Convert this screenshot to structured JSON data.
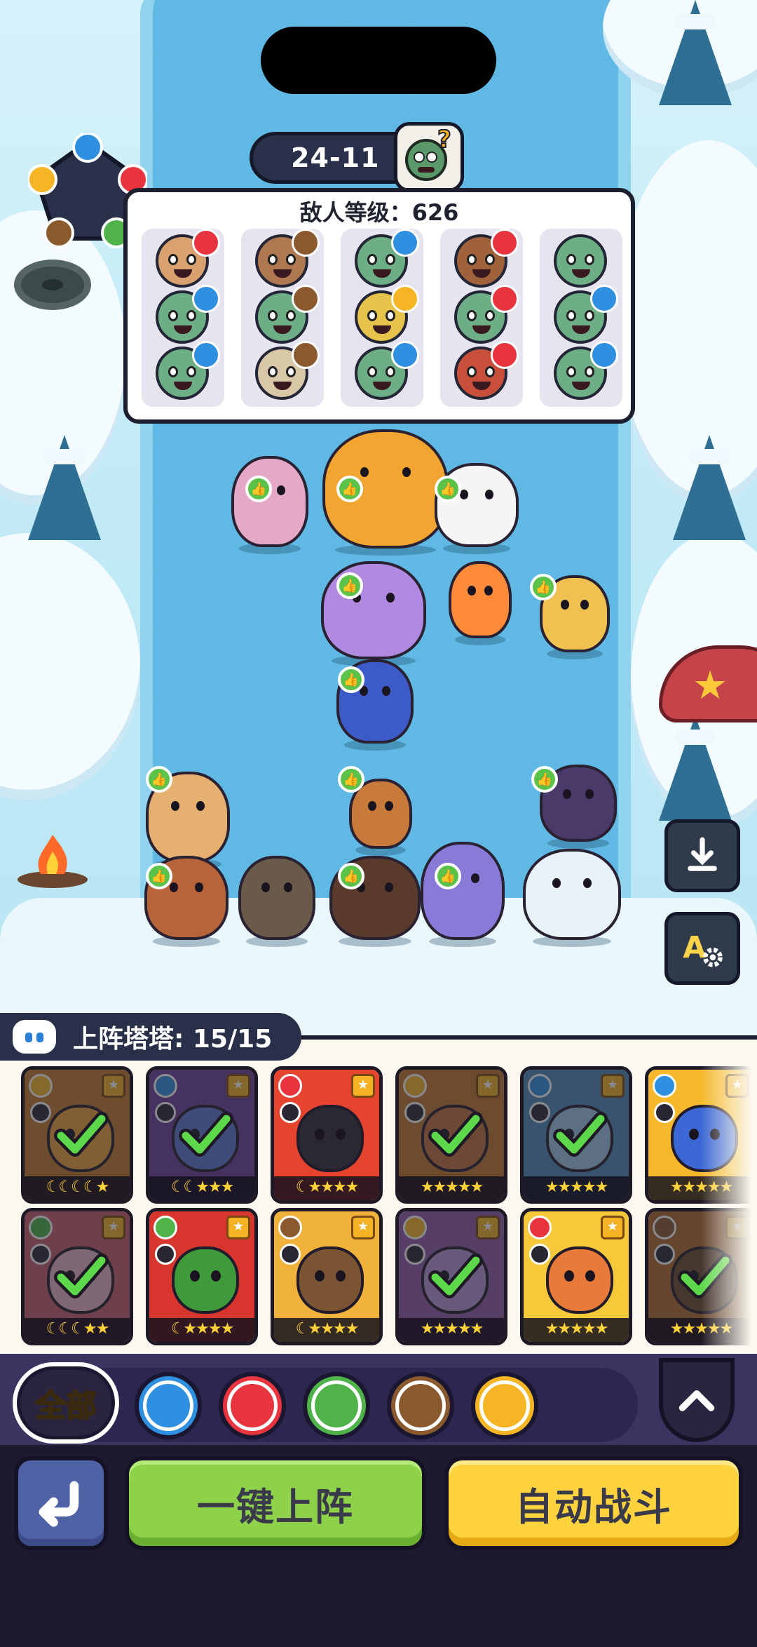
{
  "stage": {
    "label": "24-11"
  },
  "enemy_panel": {
    "title": "敌人等级：626",
    "columns": [
      {
        "enemies": [
          {
            "icon": "pirate-enemy",
            "element": "fire"
          },
          {
            "icon": "zombie-enemy",
            "element": "water"
          },
          {
            "icon": "zombie-enemy",
            "element": "water"
          }
        ]
      },
      {
        "enemies": [
          {
            "icon": "cowboy-enemy",
            "element": "earth"
          },
          {
            "icon": "zombie-enemy",
            "element": "earth"
          },
          {
            "icon": "mummy-enemy",
            "element": "earth"
          }
        ]
      },
      {
        "enemies": [
          {
            "icon": "zombie-enemy",
            "element": "water"
          },
          {
            "icon": "robot-enemy",
            "element": "lightning"
          },
          {
            "icon": "zombie-enemy",
            "element": "water"
          }
        ]
      },
      {
        "enemies": [
          {
            "icon": "bandit-enemy",
            "element": "fire"
          },
          {
            "icon": "zombie-enemy",
            "element": "fire"
          },
          {
            "icon": "brute-enemy",
            "element": "fire"
          }
        ]
      },
      {
        "enemies": [
          {
            "icon": "zombie-enemy",
            "element": "none"
          },
          {
            "icon": "zombie-enemy",
            "element": "water"
          },
          {
            "icon": "zombie-enemy",
            "element": "water"
          }
        ]
      }
    ]
  },
  "roster": {
    "label": "上阵塔塔: 15/15"
  },
  "cards_row1": [
    {
      "element": "lightning",
      "deployed": true,
      "stars": "☾☾☾☾★",
      "bg": "#c47b2a",
      "creature": "#f0a03a"
    },
    {
      "element": "water",
      "deployed": true,
      "stars": "☾☾★★★",
      "bg": "#6b3f9c",
      "creature": "#5b76d0"
    },
    {
      "element": "fire",
      "deployed": false,
      "stars": "☾★★★★",
      "bg": "#e6442f",
      "creature": "#2a2833"
    },
    {
      "element": "lightning",
      "deployed": true,
      "stars": "★★★★★",
      "bg": "#c0762e",
      "creature": "#c2713a"
    },
    {
      "element": "water",
      "deployed": true,
      "stars": "★★★★★",
      "bg": "#4c88b8",
      "creature": "#9ec8e6"
    },
    {
      "element": "water",
      "deployed": false,
      "stars": "★★★★★",
      "bg": "#f5b92b",
      "creature": "#3c68d6"
    }
  ],
  "cards_row2": [
    {
      "element": "nature",
      "deployed": true,
      "stars": "☾☾☾★★",
      "bg": "#c65d6e",
      "creature": "#e8b5c4"
    },
    {
      "element": "nature",
      "deployed": false,
      "stars": "☾★★★★",
      "bg": "#d8352e",
      "creature": "#3e9a3a"
    },
    {
      "element": "earth",
      "deployed": false,
      "stars": "☾★★★★",
      "bg": "#f0b23a",
      "creature": "#7a5433"
    },
    {
      "element": "lightning",
      "deployed": true,
      "stars": "★★★★★",
      "bg": "#8e5aa8",
      "creature": "#b896d8"
    },
    {
      "element": "fire",
      "deployed": false,
      "stars": "★★★★★",
      "bg": "#f5c93a",
      "creature": "#e87a3a"
    },
    {
      "element": "earth",
      "deployed": true,
      "stars": "★★★★★",
      "bg": "#b0692a",
      "creature": "#6a4a2e"
    }
  ],
  "filters": {
    "all_label": "全部",
    "chips": [
      {
        "name": "water",
        "color": "#2f8fe0"
      },
      {
        "name": "fire",
        "color": "#e8343e"
      },
      {
        "name": "nature",
        "color": "#4fb34a"
      },
      {
        "name": "earth",
        "color": "#8a5a2e"
      },
      {
        "name": "lightning",
        "color": "#f5b524"
      }
    ]
  },
  "buttons": {
    "auto_deploy": "一键上阵",
    "auto_battle": "自动战斗"
  },
  "colors": {
    "water": "#2f8fe0",
    "fire": "#e8343e",
    "nature": "#4fb34a",
    "earth": "#8a5a2e",
    "lightning": "#f5b524",
    "buff": "#5cc34a"
  }
}
